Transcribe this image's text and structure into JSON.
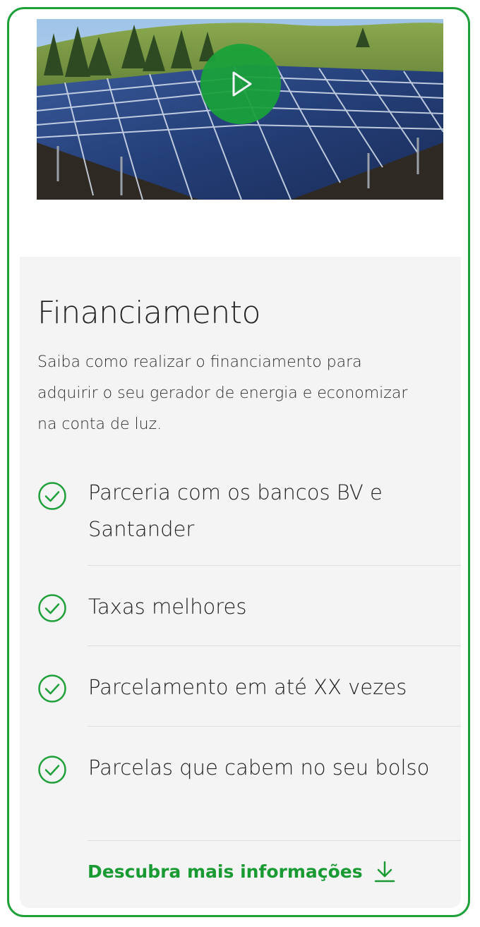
{
  "video": {
    "play_icon": "play-icon",
    "thumbnail_icon": "solar-panels-image"
  },
  "financing": {
    "title": "Financiamento",
    "description": "Saiba como realizar o financiamento para adquirir o seu gerador de energia e economizar na conta de luz.",
    "features": [
      {
        "label": "Parceria com os bancos BV e Santander",
        "icon": "check-circle-icon"
      },
      {
        "label": "Taxas melhores",
        "icon": "check-circle-icon"
      },
      {
        "label": "Parcelamento em até XX vezes",
        "icon": "check-circle-icon"
      },
      {
        "label": "Parcelas que cabem no seu bolso",
        "icon": "check-circle-icon"
      }
    ],
    "cta_label": "Descubra mais informações",
    "cta_icon": "arrow-down-icon"
  },
  "colors": {
    "accent": "#1fa03a",
    "panel_background": "#f4f4f4",
    "text": "#222222"
  }
}
